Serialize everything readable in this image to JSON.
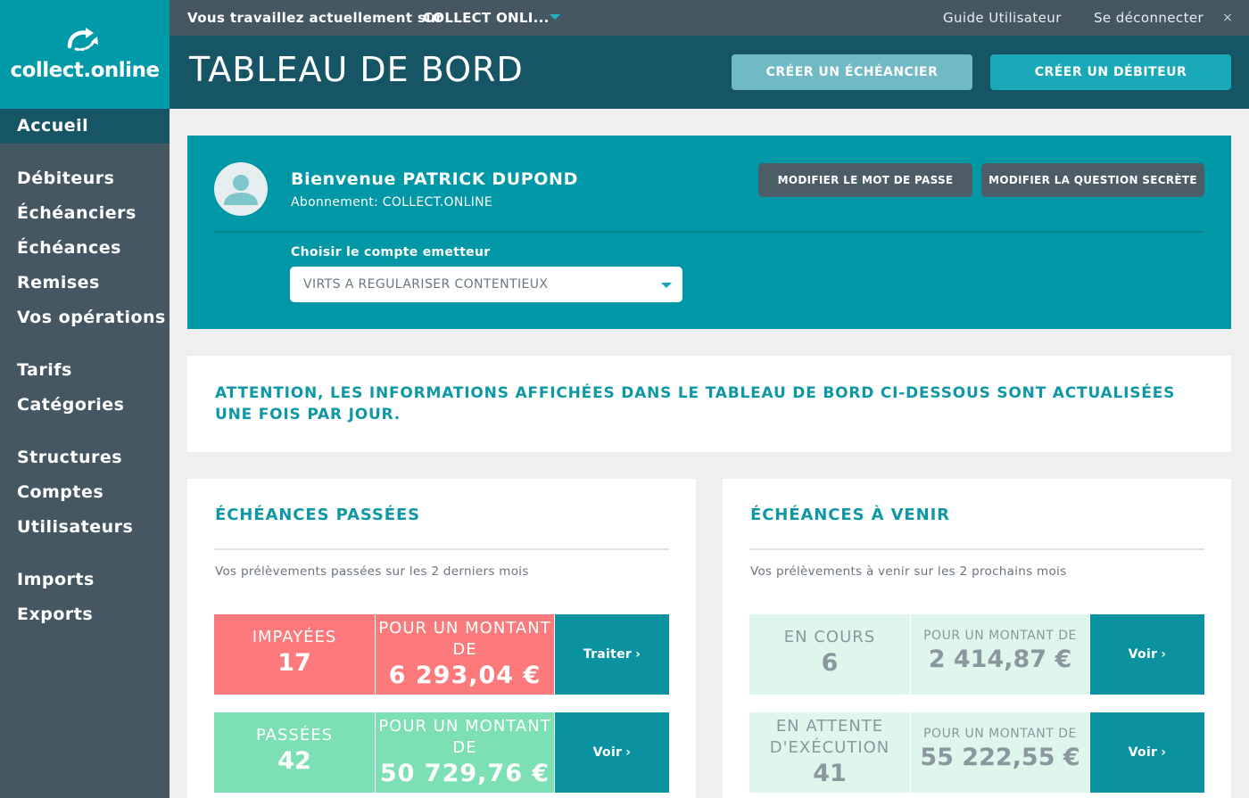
{
  "brand": {
    "logo_text": "collect.online"
  },
  "topbar": {
    "work_label": "Vous travaillez actuellement sur",
    "work_value": "COLLECT ONLI...",
    "guide": "Guide Utilisateur",
    "logout": "Se déconnecter",
    "close": "×"
  },
  "header": {
    "title": "TABLEAU DE BORD",
    "btn_echeancier": "CRÉER UN ÉCHÉANCIER",
    "btn_debiteur": "CRÉER UN DÉBITEUR"
  },
  "sidebar": {
    "items": [
      "Accueil",
      "Débiteurs",
      "Échéanciers",
      "Échéances",
      "Remises",
      "Vos opérations",
      "Tarifs",
      "Catégories",
      "Structures",
      "Comptes",
      "Utilisateurs",
      "Imports",
      "Exports"
    ]
  },
  "welcome": {
    "name": "Bienvenue PATRICK DUPOND",
    "subscription": "Abonnement: COLLECT.ONLINE",
    "btn_password": "MODIFIER LE MOT DE PASSE",
    "btn_question": "MODIFIER LA QUESTION SECRÈTE",
    "emitter_label": "Choisir le compte emetteur",
    "emitter_value": "VIRTS A REGULARISER CONTENTIEUX"
  },
  "attention": "ATTENTION, LES INFORMATIONS AFFICHÉES DANS LE TABLEAU DE BORD CI-DESSOUS SONT ACTUALISÉES UNE FOIS PAR JOUR.",
  "past": {
    "title": "ÉCHÉANCES PASSÉES",
    "subtitle": "Vos prélèvements passées sur les 2 derniers mois",
    "rows": [
      {
        "label": "IMPAYÉES",
        "count": "17",
        "amount_label": "POUR UN MONTANT DE",
        "amount": "6 293,04 €",
        "action": "Traiter"
      },
      {
        "label": "PASSÉES",
        "count": "42",
        "amount_label": "POUR UN MONTANT DE",
        "amount": "50 729,76 €",
        "action": "Voir"
      }
    ]
  },
  "upcoming": {
    "title": "ÉCHÉANCES À VENIR",
    "subtitle": "Vos prélèvements à venir sur les 2 prochains mois",
    "rows": [
      {
        "label": "EN COURS",
        "count": "6",
        "amount_label": "POUR UN MONTANT DE",
        "amount": "2 414,87 €",
        "action": "Voir"
      },
      {
        "label": "EN ATTENTE D'EXÉCUTION",
        "count": "41",
        "amount_label": "POUR UN MONTANT DE",
        "amount": "55 222,55 €",
        "action": "Voir"
      }
    ]
  },
  "colors": {
    "teal": "#0097a6",
    "dark_teal": "#155566",
    "slate": "#455763",
    "red": "#fc7a7b",
    "green": "#7ce0b4",
    "pale_green": "#dff6ec"
  }
}
